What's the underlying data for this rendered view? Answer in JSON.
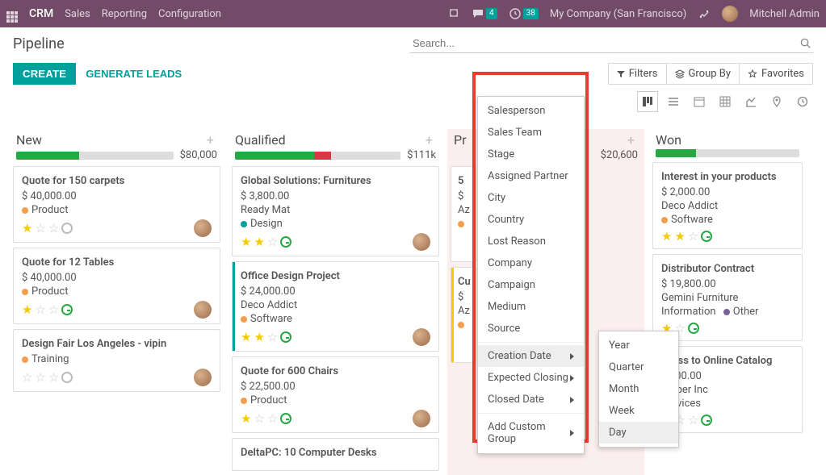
{
  "topbar": {
    "brand": "CRM",
    "nav": {
      "sales": "Sales",
      "reporting": "Reporting",
      "config": "Configuration"
    },
    "badges": {
      "chat": "4",
      "activities": "38"
    },
    "company": "My Company (San Francisco)",
    "user": "Mitchell Admin"
  },
  "header": {
    "title": "Pipeline",
    "search_placeholder": "Search...",
    "create": "CREATE",
    "generate": "GENERATE LEADS"
  },
  "filterbar": {
    "filters": "Filters",
    "groupby": "Group By",
    "favorites": "Favorites"
  },
  "groupby_menu": {
    "salesperson": "Salesperson",
    "sales_team": "Sales Team",
    "stage": "Stage",
    "assigned_partner": "Assigned Partner",
    "city": "City",
    "country": "Country",
    "lost_reason": "Lost Reason",
    "company": "Company",
    "campaign": "Campaign",
    "medium": "Medium",
    "source": "Source",
    "creation_date": "Creation Date",
    "expected_closing": "Expected Closing",
    "closed_date": "Closed Date",
    "add_custom": "Add Custom Group"
  },
  "date_submenu": {
    "year": "Year",
    "quarter": "Quarter",
    "month": "Month",
    "week": "Week",
    "day": "Day"
  },
  "columns": {
    "new": {
      "title": "New",
      "total": "$80,000"
    },
    "qualified": {
      "title": "Qualified",
      "total": "$111k"
    },
    "proposition": {
      "title": "Pr",
      "total": "$20,600"
    },
    "won": {
      "title": "Won",
      "total": ""
    }
  },
  "cards": {
    "c1": {
      "title": "Quote for 150 carpets",
      "amount": "$ 40,000.00",
      "tag": "Product"
    },
    "c2": {
      "title": "Quote for 12 Tables",
      "amount": "$ 40,000.00",
      "tag": "Product"
    },
    "c3": {
      "title": "Design Fair Los Angeles - vipin",
      "tag": "Training"
    },
    "c4": {
      "title": "Global Solutions: Furnitures",
      "amount": "$ 3,800.00",
      "customer": "Ready Mat",
      "tag": "Design"
    },
    "c5": {
      "title": "Office Design Project",
      "amount": "$ 24,000.00",
      "customer": "Deco Addict",
      "tag": "Software"
    },
    "c6": {
      "title": "Quote for 600 Chairs",
      "amount": "$ 22,500.00",
      "tag": "Product"
    },
    "c7": {
      "title": "DeltaPC: 10 Computer Desks"
    },
    "c8": {
      "title_prefix": "5",
      "customer": "Az"
    },
    "c9": {
      "title_prefix": "Cu",
      "amount": "$",
      "customer": "Az"
    },
    "c10": {
      "title": "Interest in your products",
      "amount": "$ 2,000.00",
      "customer": "Deco Addict",
      "tag": "Software"
    },
    "c11": {
      "title": "Distributor Contract",
      "amount": "$ 19,800.00",
      "customer": "Gemini Furniture",
      "tag1": "Information",
      "tag2": "Other"
    },
    "c12": {
      "title_suffix": "ccess to Online Catalog",
      "amount_suffix": "2,000.00",
      "customer_suffix": "umber Inc",
      "tag": "Services"
    }
  }
}
